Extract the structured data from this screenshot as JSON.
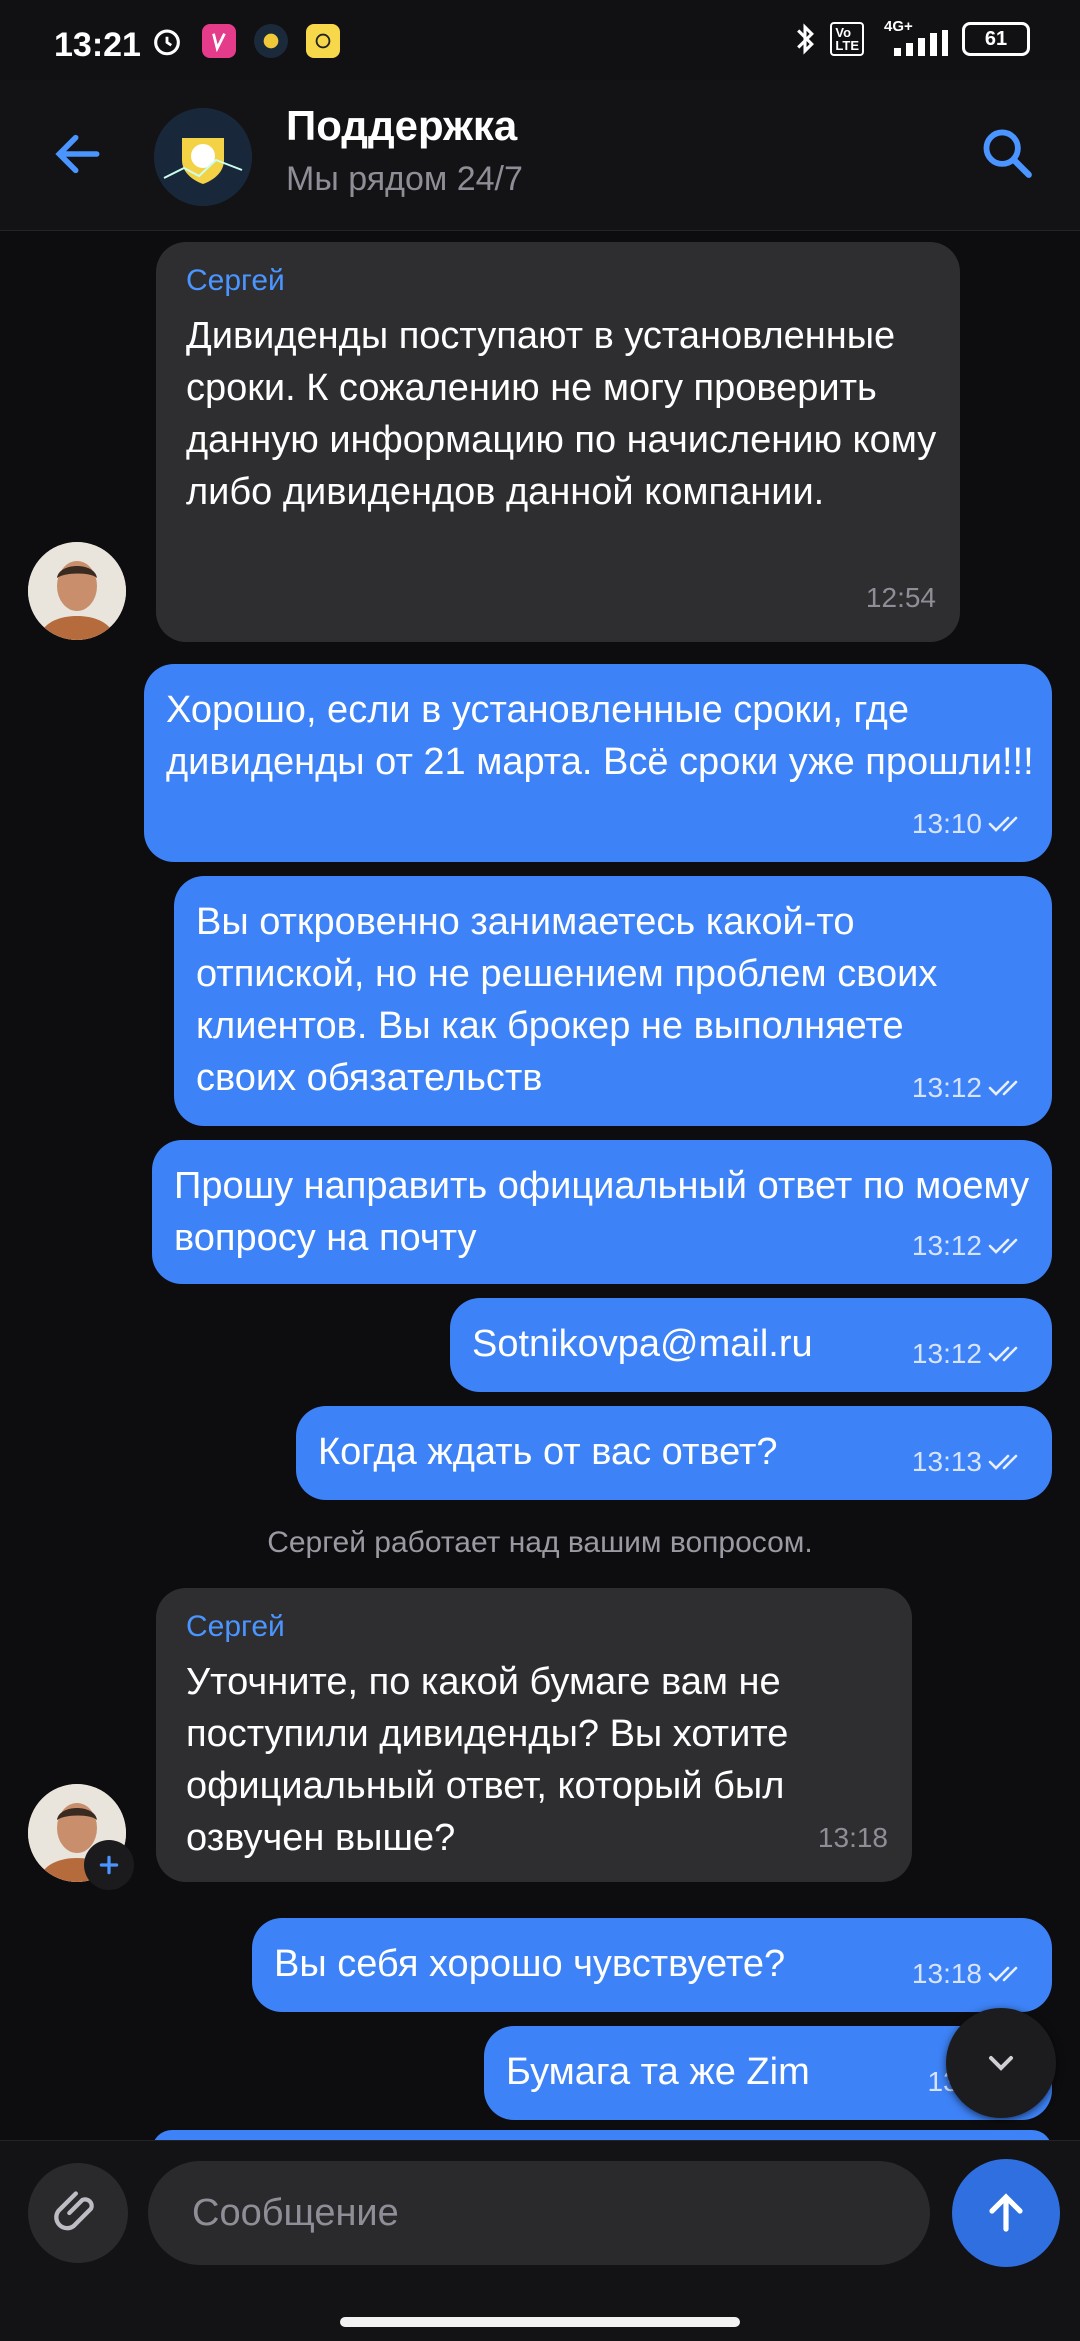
{
  "status": {
    "time": "13:21",
    "battery": "61",
    "net": "4G+"
  },
  "header": {
    "title": "Поддержка",
    "subtitle": "Мы рядом 24/7"
  },
  "messages": [
    {
      "sender": "Сергей",
      "text": "Дивиденды поступают в установленные сроки. К сожалению не могу проверить данную информацию по начислению кому либо дивидендов данной компании.",
      "time": "12:54"
    },
    {
      "text": "Хорошо, если в установленные сроки, где дивиденды от 21 марта. Всё сроки уже прошли!!!",
      "time": "13:10"
    },
    {
      "text": "Вы откровенно занимаетесь какой-то отпиской, но не решением проблем своих клиентов. Вы как брокер не выполняете своих обязательств",
      "time": "13:12"
    },
    {
      "text": "Прошу направить официальный ответ по моему вопросу на почту",
      "time": "13:12"
    },
    {
      "text": "Sotnikovpa@mail.ru",
      "time": "13:12"
    },
    {
      "text": "Когда ждать от вас ответ?",
      "time": "13:13"
    },
    {
      "sender": "Сергей",
      "text": "Уточните, по какой бумаге вам не поступили дивиденды? Вы хотите официальный ответ, который был озвучен выше?",
      "time": "13:18"
    },
    {
      "text": "Вы себя хорошо чувствуете?",
      "time": "13:18"
    },
    {
      "text": "Бумага та же Zim",
      "time": "13:1"
    }
  ],
  "system_note": "Сергей  работает над вашим вопросом.",
  "composer": {
    "placeholder": "Сообщение"
  },
  "colors": {
    "outgoing": "#3d82f6",
    "incoming": "#2e2e31",
    "accent": "#4a95ff"
  }
}
